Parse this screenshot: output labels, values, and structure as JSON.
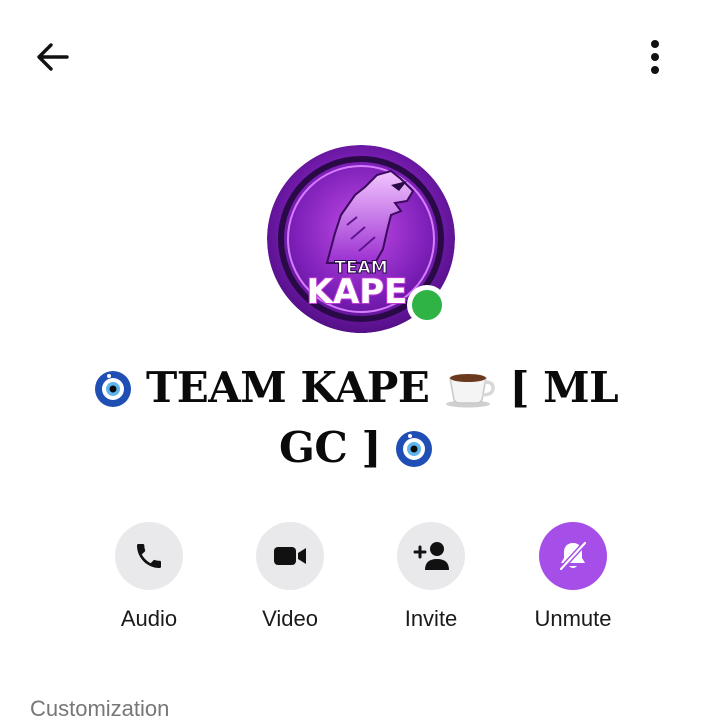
{
  "header": {
    "back_icon": "arrow-left-icon",
    "more_icon": "more-vertical-icon"
  },
  "group": {
    "name_prefix_emoji": "🧿",
    "name_part1": "TEAM KAPE",
    "cup_emoji": "☕",
    "name_part2": "[ ML",
    "name_part3": "GC ]",
    "name_suffix_emoji": "🧿",
    "avatar_text_top": "TEAM",
    "avatar_text_bottom": "KAPE",
    "online": true,
    "online_color": "#2fb344"
  },
  "actions": [
    {
      "label": "Audio",
      "icon": "phone-icon"
    },
    {
      "label": "Video",
      "icon": "video-camera-icon"
    },
    {
      "label": "Invite",
      "icon": "add-person-icon"
    },
    {
      "label": "Unmute",
      "icon": "bell-off-icon",
      "accent": "#a64ee8"
    }
  ],
  "section": {
    "label": "Customization"
  }
}
